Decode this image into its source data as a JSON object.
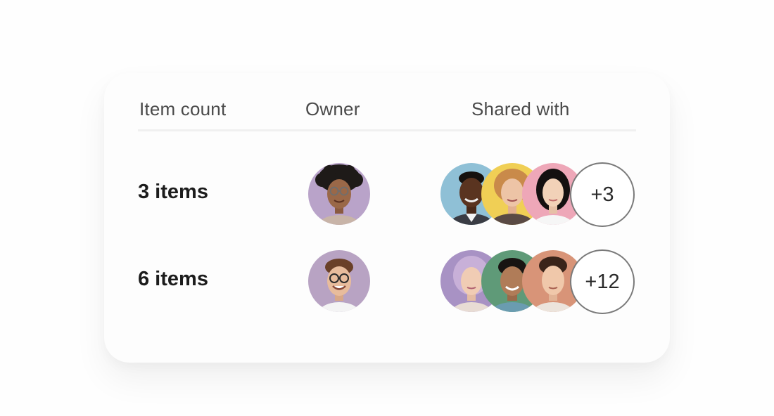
{
  "table": {
    "headers": {
      "item_count": "Item count",
      "owner": "Owner",
      "shared_with": "Shared with"
    },
    "rows": [
      {
        "count_label": "3 items",
        "owner_avatar_bg": "#b9a3c9",
        "shared_avatar_bgs": [
          "#8fc0d6",
          "#f0cf55",
          "#eea7b8"
        ],
        "more_label": "+3"
      },
      {
        "count_label": "6 items",
        "owner_avatar_bg": "#b8a3c3",
        "shared_avatar_bgs": [
          "#a892c4",
          "#5f9a78",
          "#d89478"
        ],
        "more_label": "+12"
      }
    ]
  },
  "colors": {
    "page_bg": "#fefefe",
    "card_bg": "#fdfdfd",
    "header_text": "#4a4a4a",
    "count_text": "#1c1c1c",
    "more_border": "#7a7a7a"
  }
}
